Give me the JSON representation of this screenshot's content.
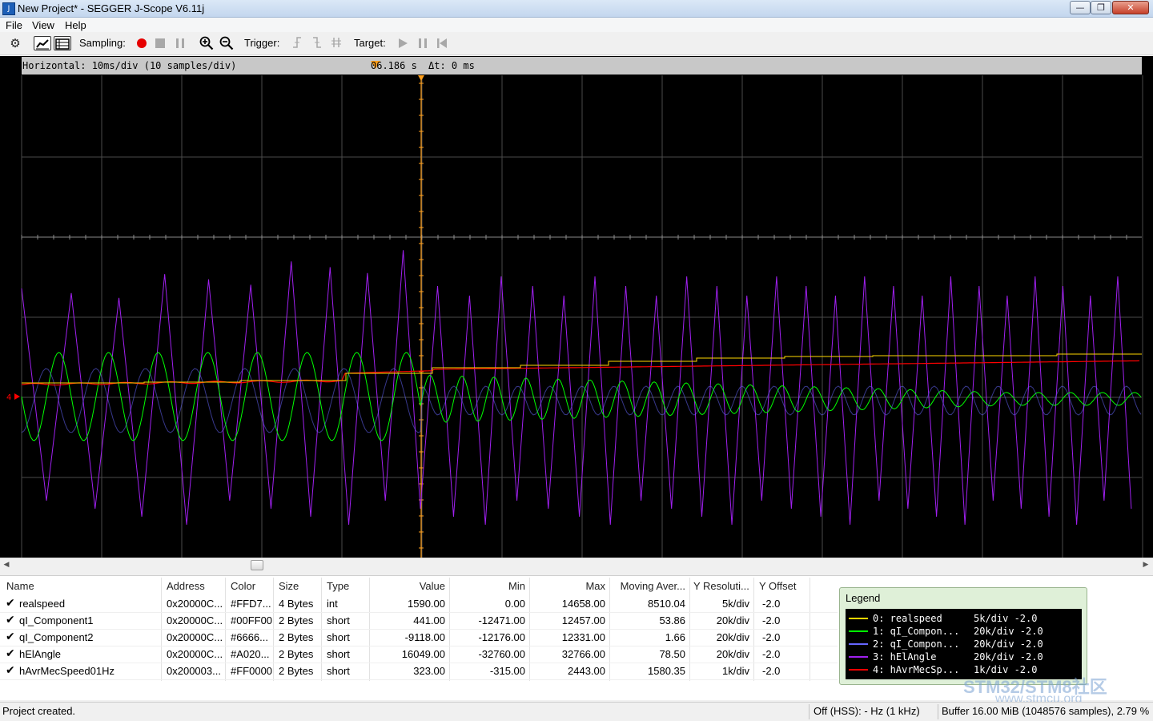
{
  "window": {
    "title": "New Project* - SEGGER J-Scope V6.11j",
    "app_icon_text": "J",
    "minimize": "—",
    "maximize": "❐",
    "close": "✕"
  },
  "menu": [
    {
      "label": "File"
    },
    {
      "label": "View"
    },
    {
      "label": "Help"
    }
  ],
  "toolbar": {
    "sampling_label": "Sampling:",
    "trigger_label": "Trigger:",
    "target_label": "Target:",
    "record_color": "#e60000"
  },
  "scope": {
    "horizontal": "Horizontal: 10ms/div (10 samples/div)",
    "time": "06.186 s",
    "delta_t": "Δt: 0 ms",
    "zero_marker": "4",
    "background": "#000000",
    "grid_color": "#4a4a4a",
    "cursor_color": "#ff9f1c"
  },
  "chart_data": {
    "type": "line",
    "x_divisions": 14,
    "y_divisions": 6,
    "series": [
      {
        "name": "realspeed",
        "color": "#FFD700",
        "description_values": "rises from near baseline to upper"
      },
      {
        "name": "qI_Component1",
        "color": "#00FF00"
      },
      {
        "name": "qI_Component2",
        "color": "#6666FF"
      },
      {
        "name": "hElAngle",
        "color": "#A020F0"
      },
      {
        "name": "hAvrMecSpeed01Hz",
        "color": "#FF0000"
      }
    ]
  },
  "table": {
    "headers": [
      "Name",
      "Address",
      "Color",
      "Size",
      "Type",
      "Value",
      "Min",
      "Max",
      "Moving Aver...",
      "Y Resoluti...",
      "Y Offset"
    ],
    "rows": [
      {
        "check": "✔",
        "name": "realspeed",
        "address": "0x20000C...",
        "color": "#FFD7...",
        "size": "4 Bytes",
        "type": "int",
        "value": "1590.00",
        "min": "0.00",
        "max": "14658.00",
        "avg": "8510.04",
        "yres": "5k/div",
        "yoff": "-2.0"
      },
      {
        "check": "✔",
        "name": "qI_Component1",
        "address": "0x20000C...",
        "color": "#00FF00",
        "size": "2 Bytes",
        "type": "short",
        "value": "441.00",
        "min": "-12471.00",
        "max": "12457.00",
        "avg": "53.86",
        "yres": "20k/div",
        "yoff": "-2.0"
      },
      {
        "check": "✔",
        "name": "qI_Component2",
        "address": "0x20000C...",
        "color": "#6666...",
        "size": "2 Bytes",
        "type": "short",
        "value": "-9118.00",
        "min": "-12176.00",
        "max": "12331.00",
        "avg": "1.66",
        "yres": "20k/div",
        "yoff": "-2.0"
      },
      {
        "check": "✔",
        "name": "hElAngle",
        "address": "0x20000C...",
        "color": "#A020...",
        "size": "2 Bytes",
        "type": "short",
        "value": "16049.00",
        "min": "-32760.00",
        "max": "32766.00",
        "avg": "78.50",
        "yres": "20k/div",
        "yoff": "-2.0"
      },
      {
        "check": "✔",
        "name": "hAvrMecSpeed01Hz",
        "address": "0x200003...",
        "color": "#FF0000",
        "size": "2 Bytes",
        "type": "short",
        "value": "323.00",
        "min": "-315.00",
        "max": "2443.00",
        "avg": "1580.35",
        "yres": "1k/div",
        "yoff": "-2.0"
      }
    ]
  },
  "legend": {
    "title": "Legend",
    "entries": [
      {
        "text": "0: realspeed",
        "res": "5k/div -2.0",
        "color": "#FFD700"
      },
      {
        "text": "1: qI_Compon...",
        "res": "20k/div -2.0",
        "color": "#00FF00"
      },
      {
        "text": "2: qI_Compon...",
        "res": "20k/div -2.0",
        "color": "#6666FF"
      },
      {
        "text": "3: hElAngle",
        "res": "20k/div -2.0",
        "color": "#A020F0"
      },
      {
        "text": "4: hAvrMecSp...",
        "res": "1k/div -2.0",
        "color": "#FF0000"
      }
    ]
  },
  "watermark": {
    "line1": "STM32/STM8社区",
    "line2": "www.stmcu.org"
  },
  "status": {
    "left": "Project created.",
    "hss": "Off (HSS): - Hz (1 kHz)",
    "buffer": "Buffer 16.00 MiB (1048576 samples), 2.79 %"
  }
}
